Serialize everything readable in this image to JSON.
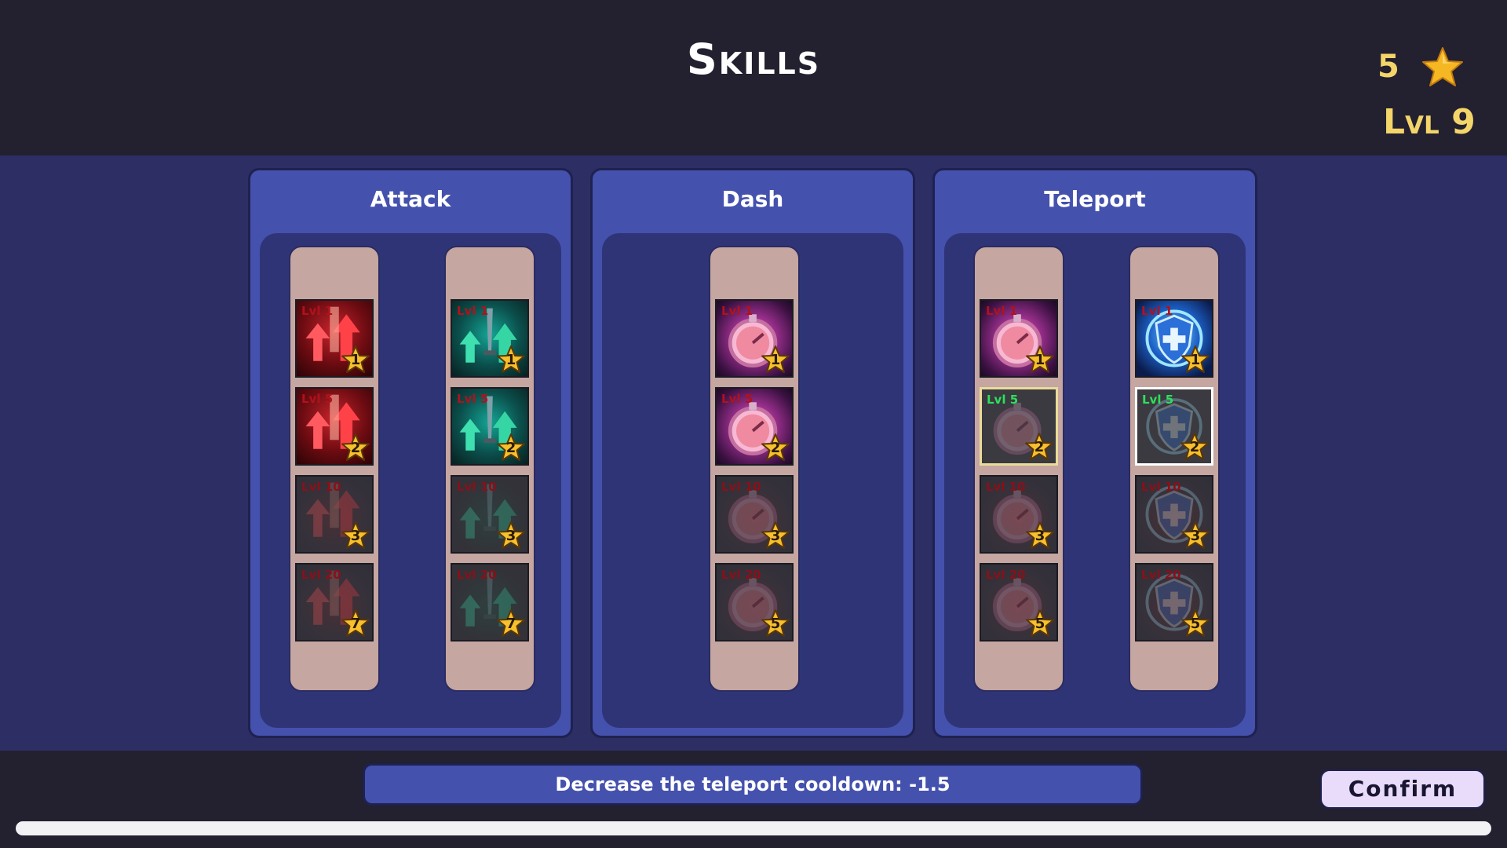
{
  "header": {
    "title": "Skills",
    "star_count": "5",
    "level": "Lvl 9"
  },
  "colors": {
    "panel": "#4451ad",
    "background": "#23202f",
    "gold": "#f3d56a",
    "unlock_green": "#2ee05a",
    "lock_red": "#b0121c"
  },
  "panels": [
    {
      "title": "Attack",
      "columns": [
        {
          "slots": [
            {
              "lvl": "Lvl 1",
              "cost": "1",
              "state": "owned",
              "art": "red-arrows-icon"
            },
            {
              "lvl": "Lvl 5",
              "cost": "2",
              "state": "owned",
              "art": "red-arrows-icon"
            },
            {
              "lvl": "Lvl 10",
              "cost": "3",
              "state": "locked",
              "art": "red-arrows-icon"
            },
            {
              "lvl": "Lvl 20",
              "cost": "7",
              "state": "locked",
              "art": "red-arrows-icon"
            }
          ]
        },
        {
          "slots": [
            {
              "lvl": "Lvl 1",
              "cost": "1",
              "state": "owned",
              "art": "teal-dagger-icon"
            },
            {
              "lvl": "Lvl 5",
              "cost": "2",
              "state": "owned",
              "art": "teal-dagger-icon"
            },
            {
              "lvl": "Lvl 10",
              "cost": "3",
              "state": "locked",
              "art": "teal-dagger-icon"
            },
            {
              "lvl": "Lvl 20",
              "cost": "7",
              "state": "locked",
              "art": "teal-dagger-icon"
            }
          ]
        }
      ]
    },
    {
      "title": "Dash",
      "columns": [
        {
          "slots": [
            {
              "lvl": "Lvl 1",
              "cost": "1",
              "state": "owned",
              "art": "stopwatch-icon"
            },
            {
              "lvl": "Lvl 5",
              "cost": "2",
              "state": "owned",
              "art": "stopwatch-icon"
            },
            {
              "lvl": "Lvl 10",
              "cost": "3",
              "state": "locked",
              "art": "stopwatch-icon"
            },
            {
              "lvl": "Lvl 20",
              "cost": "5",
              "state": "locked",
              "art": "stopwatch-icon"
            }
          ]
        }
      ]
    },
    {
      "title": "Teleport",
      "columns": [
        {
          "slots": [
            {
              "lvl": "Lvl 1",
              "cost": "1",
              "state": "owned",
              "art": "stopwatch-icon"
            },
            {
              "lvl": "Lvl 5",
              "cost": "2",
              "state": "available",
              "art": "stopwatch-icon"
            },
            {
              "lvl": "Lvl 10",
              "cost": "3",
              "state": "locked",
              "art": "stopwatch-icon"
            },
            {
              "lvl": "Lvl 20",
              "cost": "5",
              "state": "locked",
              "art": "stopwatch-icon"
            }
          ]
        },
        {
          "slots": [
            {
              "lvl": "Lvl 1",
              "cost": "1",
              "state": "owned",
              "art": "shield-cross-icon"
            },
            {
              "lvl": "Lvl 5",
              "cost": "2",
              "state": "available",
              "art": "shield-cross-icon"
            },
            {
              "lvl": "Lvl 10",
              "cost": "3",
              "state": "locked",
              "art": "shield-cross-icon"
            },
            {
              "lvl": "Lvl 20",
              "cost": "5",
              "state": "locked",
              "art": "shield-cross-icon"
            }
          ]
        }
      ]
    }
  ],
  "description": "Decrease the teleport cooldown: -1.5",
  "confirm_label": "Confirm",
  "progress": 1.0
}
